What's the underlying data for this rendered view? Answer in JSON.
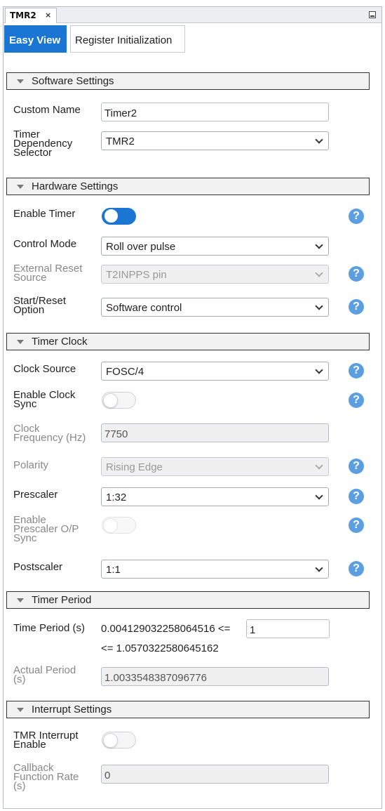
{
  "tab": {
    "title": "TMR2",
    "close": "×"
  },
  "view_tabs": {
    "easy": "Easy View",
    "register": "Register Initialization"
  },
  "software": {
    "title": "Software Settings",
    "custom_name": {
      "label": [
        "Custom",
        "Name"
      ],
      "value": "Timer2"
    },
    "dependency": {
      "label": [
        "Timer",
        "Dependency",
        "Selector"
      ],
      "value": "TMR2"
    }
  },
  "hardware": {
    "title": "Hardware Settings",
    "enable_timer": {
      "label": "Enable Timer",
      "on": true
    },
    "control_mode": {
      "label": "Control Mode",
      "value": "Roll over pulse"
    },
    "external_reset": {
      "label": [
        "External Reset",
        "Source"
      ],
      "value": "T2INPPS pin",
      "disabled": true
    },
    "start_reset": {
      "label": [
        "Start/Reset",
        "Option"
      ],
      "value": "Software control"
    }
  },
  "clock": {
    "title": "Timer Clock",
    "clock_source": {
      "label": "Clock Source",
      "value": "FOSC/4"
    },
    "enable_clock_sync": {
      "label": [
        "Enable Clock",
        "Sync"
      ],
      "on": false
    },
    "clock_frequency": {
      "label": [
        "Clock",
        "Frequency (Hz)"
      ],
      "value": "7750"
    },
    "polarity": {
      "label": "Polarity",
      "value": "Rising Edge",
      "disabled": true
    },
    "prescaler": {
      "label": "Prescaler",
      "value": "1:32"
    },
    "prescaler_sync": {
      "label": [
        "Enable",
        "Prescaler O/P",
        "Sync"
      ],
      "on": false,
      "disabled": true
    },
    "postscaler": {
      "label": "Postscaler",
      "value": "1:1"
    }
  },
  "period": {
    "title": "Timer Period",
    "time_period": {
      "label": "Time Period (s)",
      "min": "0.004129032258064516 <=",
      "value": "1",
      "max": "<= 1.0570322580645162"
    },
    "actual_period": {
      "label": [
        "Actual Period",
        "(s)"
      ],
      "value": "1.0033548387096776"
    }
  },
  "interrupt": {
    "title": "Interrupt Settings",
    "tmr_interrupt": {
      "label": [
        "TMR Interrupt",
        "Enable"
      ],
      "on": false
    },
    "callback_rate": {
      "label": [
        "Callback",
        "Function Rate",
        "(s)"
      ],
      "value": "0"
    }
  },
  "help_glyph": "?",
  "colors": {
    "accent": "#1a76d2",
    "help": "#5c9fe0",
    "section_bg": "#f2f2f2"
  }
}
